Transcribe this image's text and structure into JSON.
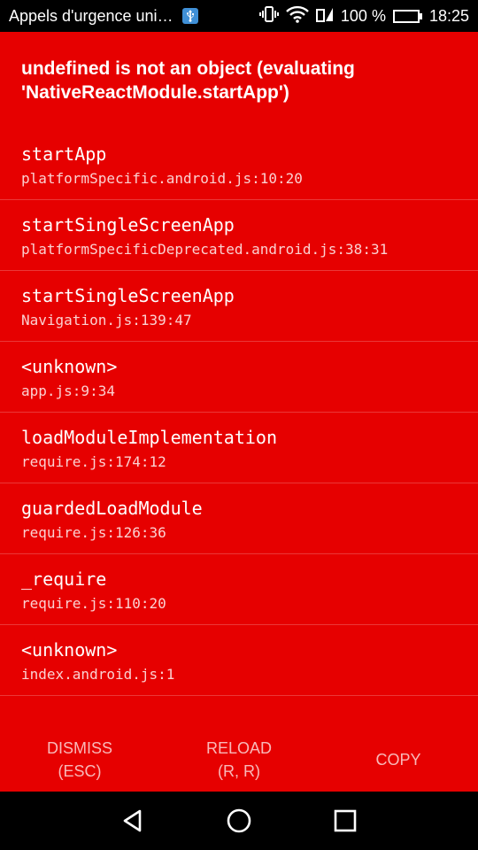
{
  "status_bar": {
    "notification_text": "Appels d'urgence uni…",
    "battery_percent": "100 %",
    "time": "18:25",
    "icons": [
      "usb-icon",
      "vibrate-icon",
      "wifi-icon",
      "signal-icon",
      "battery-charging-icon"
    ],
    "battery_fill_color": "#4caf50"
  },
  "error": {
    "title_line1": "undefined is not an object (evaluating",
    "title_line2": "'NativeReactModule.startApp')",
    "background_color": "#e60000"
  },
  "stack": [
    {
      "method": "startApp",
      "location": "platformSpecific.android.js:10:20"
    },
    {
      "method": "startSingleScreenApp",
      "location": "platformSpecificDeprecated.android.js:38:31"
    },
    {
      "method": "startSingleScreenApp",
      "location": "Navigation.js:139:47"
    },
    {
      "method": "<unknown>",
      "location": "app.js:9:34"
    },
    {
      "method": "loadModuleImplementation",
      "location": "require.js:174:12"
    },
    {
      "method": "guardedLoadModule",
      "location": "require.js:126:36"
    },
    {
      "method": "_require",
      "location": "require.js:110:20"
    },
    {
      "method": "<unknown>",
      "location": "index.android.js:1"
    }
  ],
  "buttons": {
    "dismiss_line1": "DISMISS",
    "dismiss_line2": "(ESC)",
    "reload_line1": "RELOAD",
    "reload_line2": "(R, R)",
    "copy": "COPY"
  },
  "nav_bar": {
    "icons": [
      "back-icon",
      "home-icon",
      "recents-icon"
    ]
  }
}
